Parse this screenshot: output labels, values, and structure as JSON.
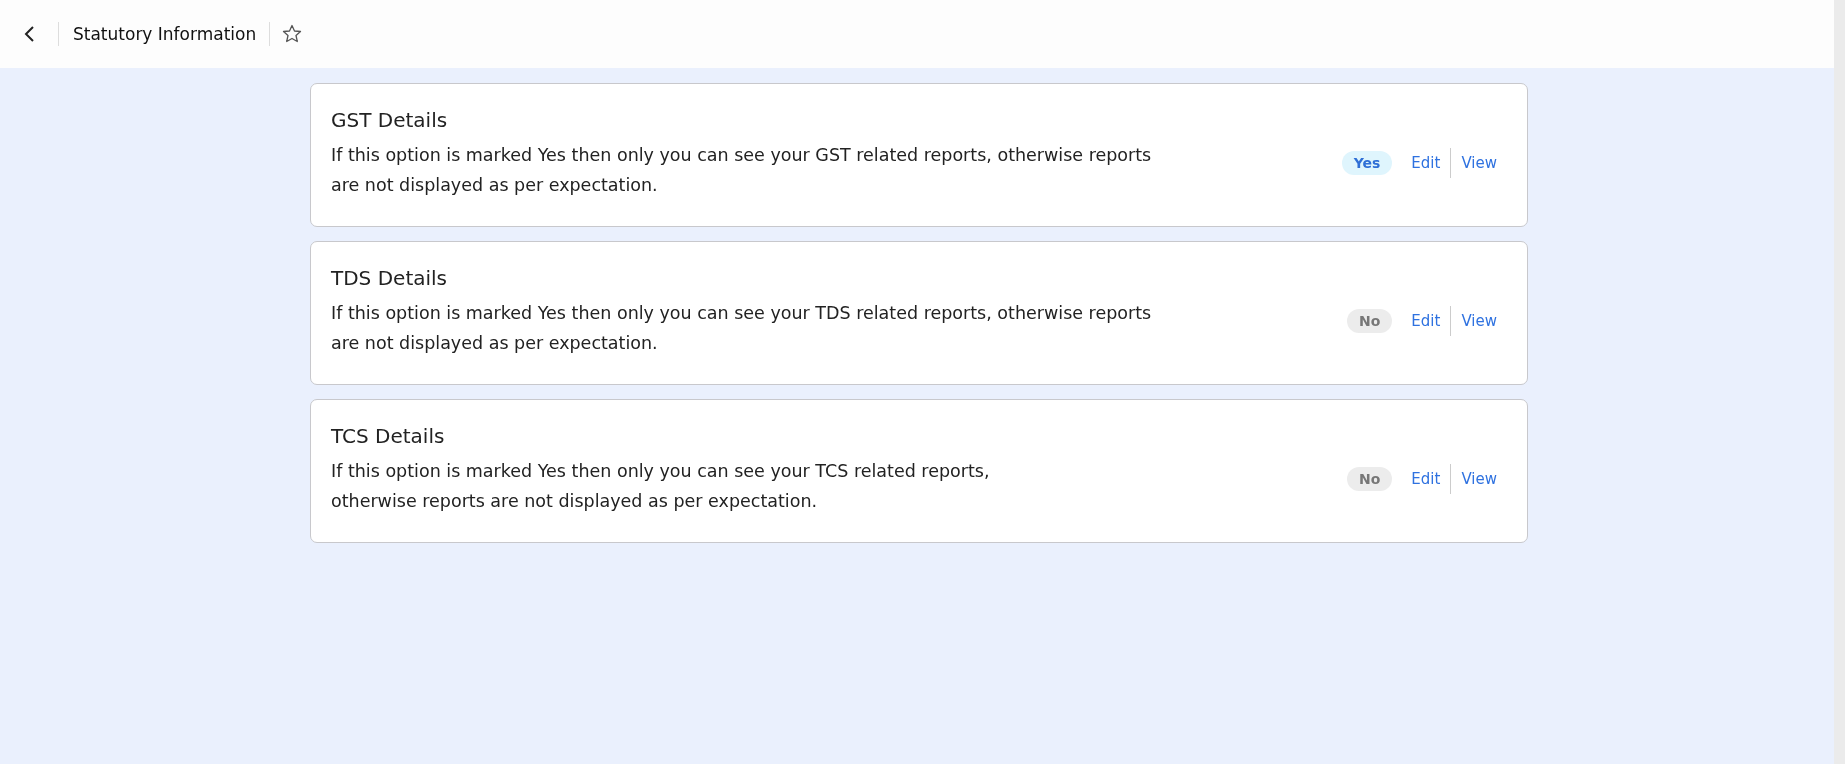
{
  "header": {
    "title": "Statutory Information",
    "favorite": false
  },
  "cards": [
    {
      "title": "GST Details",
      "description_lines": [
        "If this option is marked Yes then only you can see your GST related reports, otherwise reports",
        "are not displayed as per expectation."
      ],
      "status": {
        "text": "Yes",
        "on": true
      },
      "actions": [
        "Edit",
        "View"
      ]
    },
    {
      "title": "TDS Details",
      "description_lines": [
        "If this option is marked Yes then only you can see your TDS related reports, otherwise reports",
        "are not displayed as per expectation."
      ],
      "status": {
        "text": "No",
        "on": false
      },
      "actions": [
        "Edit",
        "View"
      ]
    },
    {
      "title": "TCS Details",
      "description_lines": [
        "If this option is marked Yes then only you can see your TCS related reports,",
        "otherwise reports are not displayed as per expectation."
      ],
      "status": {
        "text": "No",
        "on": false
      },
      "actions": [
        "Edit",
        "View"
      ]
    }
  ]
}
